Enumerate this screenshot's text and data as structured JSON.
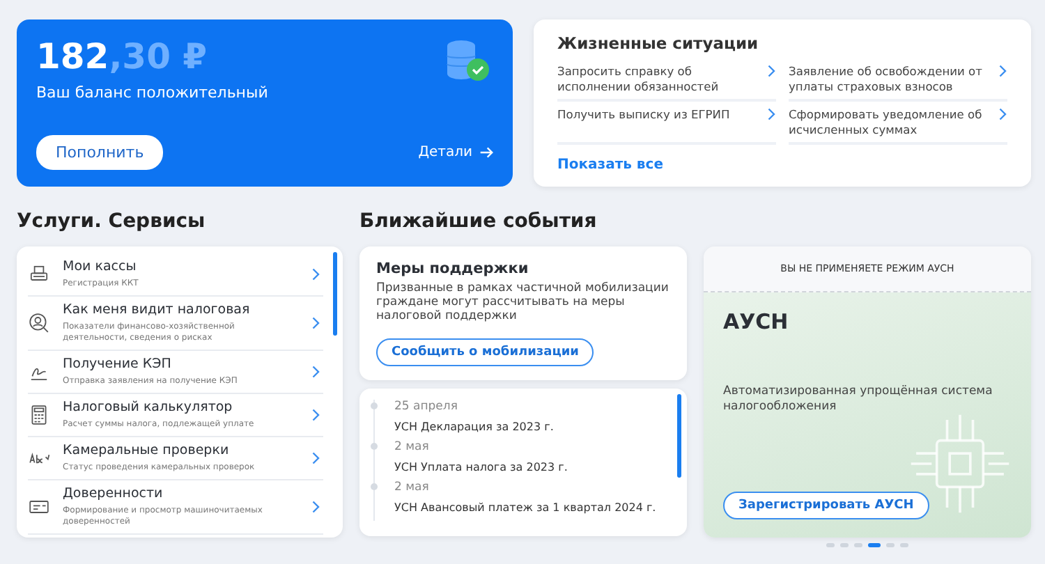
{
  "balance": {
    "amount_whole": "182",
    "amount_fraction": ",30 ₽",
    "caption": "Ваш баланс положительный",
    "topup_button": "Пополнить",
    "details_link": "Детали"
  },
  "life_situations": {
    "title": "Жизненные ситуации",
    "items": [
      {
        "label": "Запросить справку об исполнении обязанностей"
      },
      {
        "label": "Заявление об освобождении от уплаты страховых взносов"
      },
      {
        "label": "Получить выписку из ЕГРИП"
      },
      {
        "label": "Сформировать уведомление об исчисленных суммах"
      }
    ],
    "show_all": "Показать все"
  },
  "services": {
    "title": "Услуги. Сервисы",
    "items": [
      {
        "kind": "register",
        "title": "Мои кассы",
        "subtitle": "Регистрация ККТ"
      },
      {
        "kind": "person",
        "title": "Как меня видит налоговая",
        "subtitle": "Показатели финансово-хозяйственной деятельности, сведения о рисках"
      },
      {
        "kind": "signature",
        "title": "Получение КЭП",
        "subtitle": "Отправка заявления на получение КЭП"
      },
      {
        "kind": "calculator",
        "title": "Налоговый калькулятор",
        "subtitle": "Расчет суммы налога, подлежащей уплате"
      },
      {
        "kind": "abc",
        "title": "Камеральные проверки",
        "subtitle": "Статус проведения камеральных проверок"
      },
      {
        "kind": "document",
        "title": "Доверенности",
        "subtitle": "Формирование и просмотр машиночитаемых доверенностей"
      }
    ]
  },
  "events": {
    "title": "Ближайшие события",
    "support": {
      "title": "Меры поддержки",
      "text": "Призванные в рамках частичной мобилизации граждане могут рассчитывать на меры налоговой поддержки",
      "button": "Сообщить о мобилизации"
    },
    "items": [
      {
        "date": "25 апреля",
        "title": "УСН Декларация за 2023 г."
      },
      {
        "date": "2 мая",
        "title": "УСН Уплата налога за 2023 г."
      },
      {
        "date": "2 мая",
        "title": "УСН Авансовый платеж за 1 квартал 2024 г."
      }
    ]
  },
  "promo": {
    "banner": "ВЫ НЕ ПРИМЕНЯЕТЕ РЕЖИМ АУСН",
    "title": "АУСН",
    "text": "Автоматизированная упрощённая система налогообложения",
    "button": "Зарегистрировать АУСН",
    "dots": [
      {
        "selected": false
      },
      {
        "selected": false
      },
      {
        "selected": false
      },
      {
        "selected": true
      },
      {
        "selected": false
      },
      {
        "selected": false
      }
    ]
  }
}
